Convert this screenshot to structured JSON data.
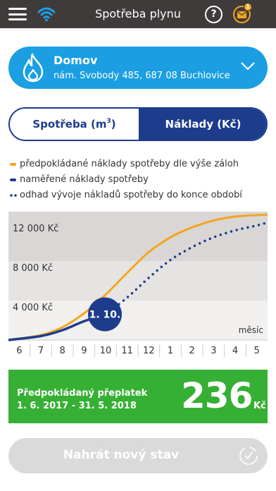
{
  "header": {
    "title": "Spotřeba plynu",
    "help_label": "?",
    "notification_count": "1",
    "icons": [
      "menu-icon",
      "wifi-icon",
      "help-icon",
      "mail-icon"
    ]
  },
  "place": {
    "name": "Domov",
    "address": "nám. Svobody 485, 687 08 Buchlovice",
    "icon": "flame-icon"
  },
  "toggle": {
    "left_label": "Spotřeba (m",
    "left_sup": "3",
    "left_suffix": ")",
    "right_label": "Náklady (Kč)",
    "selected": "right"
  },
  "legend": [
    {
      "text": "předpokládané náklady spotřeby dle výše záloh",
      "marker": "orange-line"
    },
    {
      "text": "naměřené náklady spotřeby",
      "marker": "blue-line"
    },
    {
      "text": "odhad vývoje nákladů spotřeby do konce období",
      "marker": "blue-dots"
    }
  ],
  "colors": {
    "accent_blue": "#1b9fe2",
    "navy": "#1d3c8c",
    "orange": "#f4a51c",
    "green": "#36b034",
    "topbar": "#3e3b3a"
  },
  "chart_data": {
    "type": "line",
    "x": [
      "6",
      "7",
      "8",
      "9",
      "10",
      "11",
      "12",
      "1",
      "2",
      "3",
      "4",
      "5"
    ],
    "y_ticks": [
      {
        "value": 4000,
        "label": "4 000 Kč"
      },
      {
        "value": 8000,
        "label": "8 000 Kč"
      },
      {
        "value": 12000,
        "label": "12 000 Kč"
      }
    ],
    "ylim": [
      0,
      13000
    ],
    "xlabel": "měsíc",
    "current_marker": "1. 10.",
    "series": [
      {
        "values": [
          0,
          500,
          1300,
          2700,
          4600,
          6800,
          8900,
          10400,
          11400,
          12100,
          12500,
          12700
        ]
      },
      {
        "values": [
          0,
          400,
          1000,
          1900,
          2600
        ]
      },
      {
        "values": [
          2600,
          4300,
          6300,
          8100,
          9400,
          10400,
          11100,
          11600,
          11900
        ]
      }
    ]
  },
  "summary": {
    "label": "Předpokládaný přeplatek",
    "period": "1. 6. 2017 - 31. 5. 2018",
    "value": "236",
    "unit": "Kč"
  },
  "upload": {
    "label": "Nahrát nový stav",
    "icon": "check-circle-icon"
  }
}
